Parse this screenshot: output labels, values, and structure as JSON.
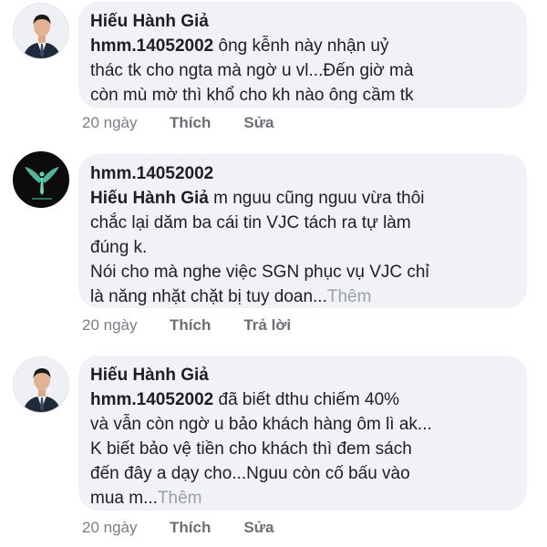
{
  "comments": [
    {
      "author": "Hiếu Hành Giả",
      "mention": "hmm.14052002",
      "text": [
        " ông kễnh này nhận uỷ",
        "thác tk cho ngta mà ngờ u vl...Đến giờ mà",
        "còn mù mờ thì khổ cho kh nào ông cầm tk"
      ],
      "more": "",
      "time": "20 ngày",
      "actions": [
        "Thích",
        "Sửa"
      ],
      "avatar_icon": "person-avatar-icon"
    },
    {
      "author": "hmm.14052002",
      "mention": "Hiếu Hành Giả",
      "text": [
        "  m nguu cũng nguu vừa thôi",
        "chắc lại dăm ba cái tin VJC tách ra tự làm",
        "đúng k.",
        "Nói cho mà nghe việc SGN phục vụ VJC chỉ",
        "là năng nhặt chặt bị tuy doan..."
      ],
      "more": "Thêm",
      "time": "20 ngày",
      "actions": [
        "Thích",
        "Trả lời"
      ],
      "avatar_icon": "wings-logo-avatar-icon"
    },
    {
      "author": "Hiếu Hành Giả",
      "mention": "hmm.14052002",
      "text": [
        " đã biết dthu chiếm 40%",
        "và vẫn còn ngờ u bảo khách hàng ôm lì ak...",
        "K biết bảo vệ tiền cho khách thì đem sách",
        "đến đây a dạy cho...Nguu còn cố bấu vào",
        "mua m..."
      ],
      "more": "Thêm",
      "time": "20 ngày",
      "actions": [
        "Thích",
        "Sửa"
      ],
      "avatar_icon": "person-avatar-icon"
    }
  ]
}
